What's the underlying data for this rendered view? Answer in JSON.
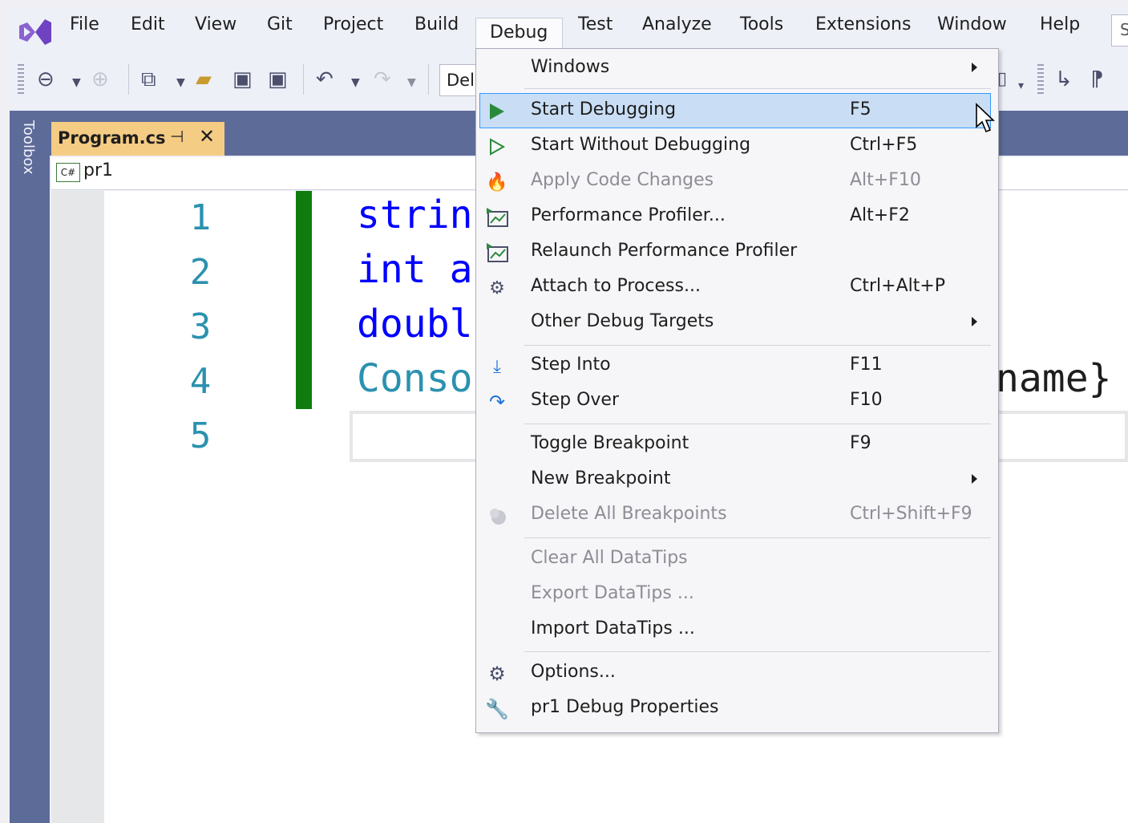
{
  "menubar": {
    "items": [
      "File",
      "Edit",
      "View",
      "Git",
      "Project",
      "Build",
      "Debug",
      "Test",
      "Analyze",
      "Tools",
      "Extensions",
      "Window",
      "Help"
    ],
    "overflow_text": "S"
  },
  "toolbar": {
    "config_partial": "Del"
  },
  "toolbox": {
    "label": "Toolbox"
  },
  "tab": {
    "title": "Program.cs",
    "pin": "⊣",
    "close": "✕"
  },
  "navbar": {
    "lang_badge": "C#",
    "project": "pr1"
  },
  "editor": {
    "line_numbers": [
      "1",
      "2",
      "3",
      "4",
      "5"
    ],
    "lines": [
      {
        "text": "strin",
        "color": "#0000ff"
      },
      {
        "text": "int a",
        "color": "#0000ff"
      },
      {
        "text": "doubl",
        "color": "#0000ff"
      },
      {
        "text": "Conso",
        "color": "#2b91af"
      }
    ],
    "right_fragment": "name}"
  },
  "debug_menu": {
    "items": [
      {
        "label": "Windows",
        "shortcut": "",
        "submenu": true,
        "disabled": false,
        "icon": ""
      },
      {
        "label": "Start Debugging",
        "shortcut": "F5",
        "submenu": false,
        "disabled": false,
        "icon": "play-filled-icon",
        "highlighted": true
      },
      {
        "label": "Start Without Debugging",
        "shortcut": "Ctrl+F5",
        "submenu": false,
        "disabled": false,
        "icon": "play-outline-icon"
      },
      {
        "label": "Apply Code Changes",
        "shortcut": "Alt+F10",
        "submenu": false,
        "disabled": true,
        "icon": "hot-reload-icon"
      },
      {
        "label": "Performance Profiler...",
        "shortcut": "Alt+F2",
        "submenu": false,
        "disabled": false,
        "icon": "profiler-icon"
      },
      {
        "label": "Relaunch Performance Profiler",
        "shortcut": "",
        "submenu": false,
        "disabled": false,
        "icon": "profiler-relaunch-icon"
      },
      {
        "label": "Attach to Process...",
        "shortcut": "Ctrl+Alt+P",
        "submenu": false,
        "disabled": false,
        "icon": "gears-icon"
      },
      {
        "label": "Other Debug Targets",
        "shortcut": "",
        "submenu": true,
        "disabled": false,
        "icon": ""
      },
      {
        "label": "Step Into",
        "shortcut": "F11",
        "submenu": false,
        "disabled": false,
        "icon": "step-into-icon"
      },
      {
        "label": "Step Over",
        "shortcut": "F10",
        "submenu": false,
        "disabled": false,
        "icon": "step-over-icon"
      },
      {
        "label": "Toggle Breakpoint",
        "shortcut": "F9",
        "submenu": false,
        "disabled": false,
        "icon": ""
      },
      {
        "label": "New Breakpoint",
        "shortcut": "",
        "submenu": true,
        "disabled": false,
        "icon": ""
      },
      {
        "label": "Delete All Breakpoints",
        "shortcut": "Ctrl+Shift+F9",
        "submenu": false,
        "disabled": true,
        "icon": "delete-breakpoints-icon"
      },
      {
        "label": "Clear All DataTips",
        "shortcut": "",
        "submenu": false,
        "disabled": true,
        "icon": ""
      },
      {
        "label": "Export DataTips ...",
        "shortcut": "",
        "submenu": false,
        "disabled": true,
        "icon": ""
      },
      {
        "label": "Import DataTips ...",
        "shortcut": "",
        "submenu": false,
        "disabled": false,
        "icon": ""
      },
      {
        "label": "Options...",
        "shortcut": "",
        "submenu": false,
        "disabled": false,
        "icon": "gear-icon"
      },
      {
        "label": "pr1 Debug Properties",
        "shortcut": "",
        "submenu": false,
        "disabled": false,
        "icon": "wrench-icon"
      }
    ]
  },
  "colors": {
    "accent": "#5d6b99",
    "tab_active": "#f5cc84",
    "change_bar": "#107c10",
    "highlight": "#c9def5"
  }
}
